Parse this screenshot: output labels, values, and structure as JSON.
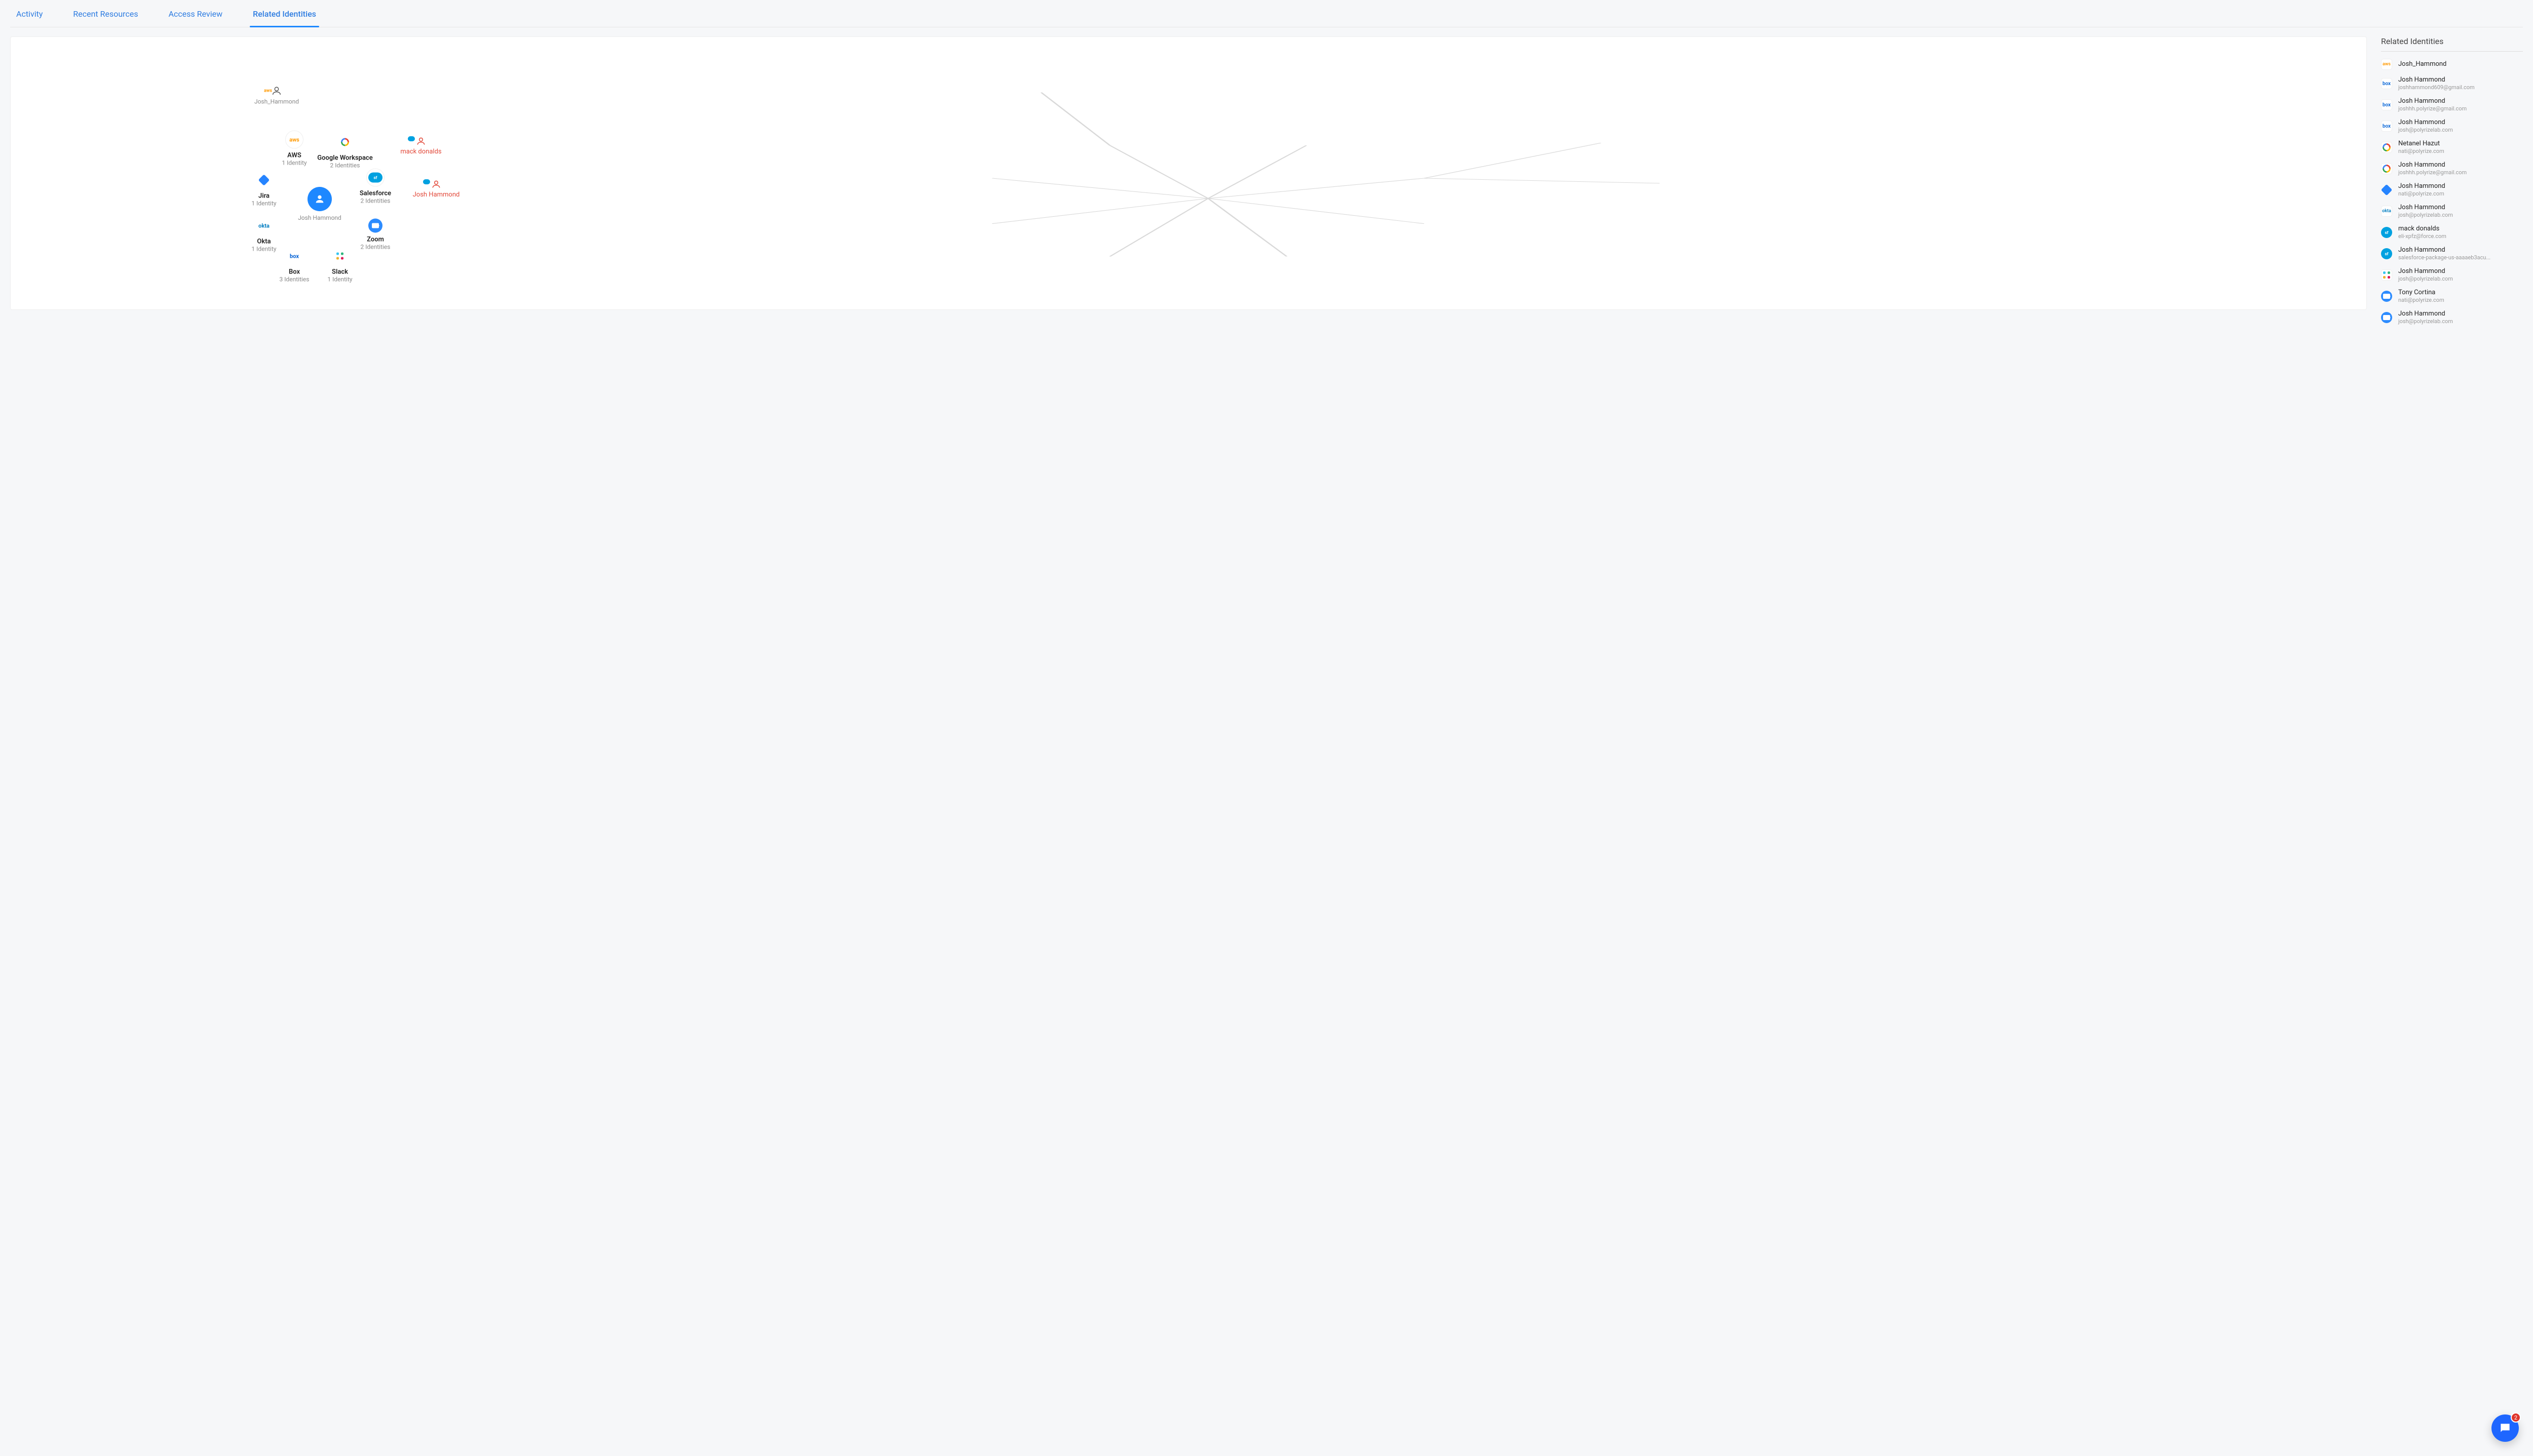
{
  "tabs": [
    {
      "label": "Activity",
      "active": false
    },
    {
      "label": "Recent Resources",
      "active": false
    },
    {
      "label": "Access Review",
      "active": false
    },
    {
      "label": "Related Identities",
      "active": true
    }
  ],
  "sidebar": {
    "title": "Related Identities",
    "items": [
      {
        "icon": "aws",
        "name": "Josh_Hammond",
        "sub": ""
      },
      {
        "icon": "box",
        "name": "Josh Hammond",
        "sub": "joshhammond609@gmail.com"
      },
      {
        "icon": "box",
        "name": "Josh Hammond",
        "sub": "joshhh.polyrize@gmail.com"
      },
      {
        "icon": "box",
        "name": "Josh Hammond",
        "sub": "josh@polyrizelab.com"
      },
      {
        "icon": "google",
        "name": "Netanel Hazut",
        "sub": "nati@polyrize.com"
      },
      {
        "icon": "google",
        "name": "Josh Hammond",
        "sub": "joshhh.polyrize@gmail.com"
      },
      {
        "icon": "jira",
        "name": "Josh Hammond",
        "sub": "nati@polyrize.com"
      },
      {
        "icon": "okta",
        "name": "Josh Hammond",
        "sub": "josh@polyrizelab.com"
      },
      {
        "icon": "sf",
        "name": "mack donalds",
        "sub": "eli-xpfz@force.com"
      },
      {
        "icon": "sf",
        "name": "Josh Hammond",
        "sub": "salesforce-package-us-aaaaeb3acu..."
      },
      {
        "icon": "slack",
        "name": "Josh Hammond",
        "sub": "josh@polyrizelab.com"
      },
      {
        "icon": "zoom",
        "name": "Tony Cortina",
        "sub": "nati@polyrize.com"
      },
      {
        "icon": "zoom",
        "name": "Josh Hammond",
        "sub": "josh@polyrizelab.com"
      }
    ]
  },
  "graph": {
    "center": {
      "name": "Josh Hammond",
      "type": "user"
    },
    "top_user": {
      "name": "Josh_Hammond",
      "provider": "aws"
    },
    "externals": [
      {
        "name": "mack donalds",
        "provider": "sf"
      },
      {
        "name": "Josh Hammond",
        "provider": "sf"
      }
    ],
    "apps": [
      {
        "key": "aws",
        "title": "AWS",
        "sub": "1 Identity",
        "ringed": true
      },
      {
        "key": "google",
        "title": "Google Workspace",
        "sub": "2 Identities"
      },
      {
        "key": "jira",
        "title": "Jira",
        "sub": "1 Identity"
      },
      {
        "key": "okta",
        "title": "Okta",
        "sub": "1 Identity"
      },
      {
        "key": "box",
        "title": "Box",
        "sub": "3 Identities"
      },
      {
        "key": "slack",
        "title": "Slack",
        "sub": "1 Identity"
      },
      {
        "key": "zoom",
        "title": "Zoom",
        "sub": "2 Identities"
      },
      {
        "key": "sf",
        "title": "Salesforce",
        "sub": "2 Identities",
        "ringed": true
      }
    ]
  },
  "chat_badge": "2"
}
